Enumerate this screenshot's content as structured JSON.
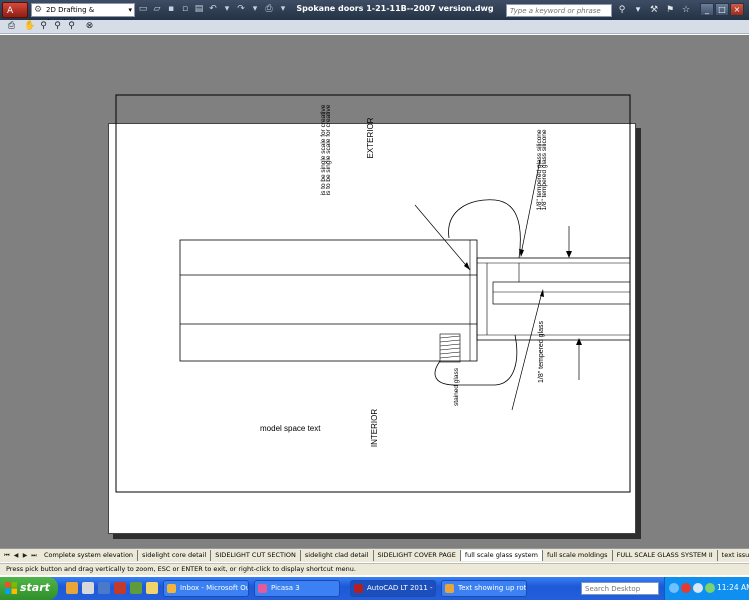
{
  "titlebar": {
    "app_letter": "A",
    "workspace": "2D Drafting & Annotation",
    "window_title": "Spokane doors 1-21-11B--2007 version.dwg",
    "search_placeholder": "Type a keyword or phrase",
    "help": "?"
  },
  "drawing": {
    "exterior": "EXTERIOR",
    "interior": "INTERIOR",
    "model_space_text": "model space text",
    "vertical_note": "is to be single scale for creative",
    "silicone_note": "1/8\" tempered glass silicone",
    "tempered_glass": "1/8\" tempered glass",
    "stained_glass": "stained glass"
  },
  "tabs": [
    {
      "label": "Complete system elevation"
    },
    {
      "label": "sidelight core detail"
    },
    {
      "label": "SIDELIGHT CUT SECTION"
    },
    {
      "label": "sidelight clad detail"
    },
    {
      "label": "SIDELIGHT COVER PAGE"
    },
    {
      "label": "full scale glass system"
    },
    {
      "label": "full scale moldings"
    },
    {
      "label": "FULL SCALE GLASS SYSTEM II"
    },
    {
      "label": "text issue"
    }
  ],
  "status": {
    "text": "Press pick button and drag vertically to zoom, ESC or ENTER to exit, or right-click to display shortcut menu."
  },
  "taskbar": {
    "start": "start",
    "tasks": [
      {
        "label": "Inbox - Microsoft Out..."
      },
      {
        "label": "Picasa 3"
      },
      {
        "label": "AutoCAD LT 2011 - [..."
      },
      {
        "label": "Text showing up rota..."
      }
    ],
    "search_placeholder": "Search Desktop",
    "clock": "11:24 AM"
  },
  "colors": {
    "canvas": "#808080",
    "title_bar": "#2f3d52",
    "taskbar": "#245edb",
    "start": "#3a9a34"
  }
}
